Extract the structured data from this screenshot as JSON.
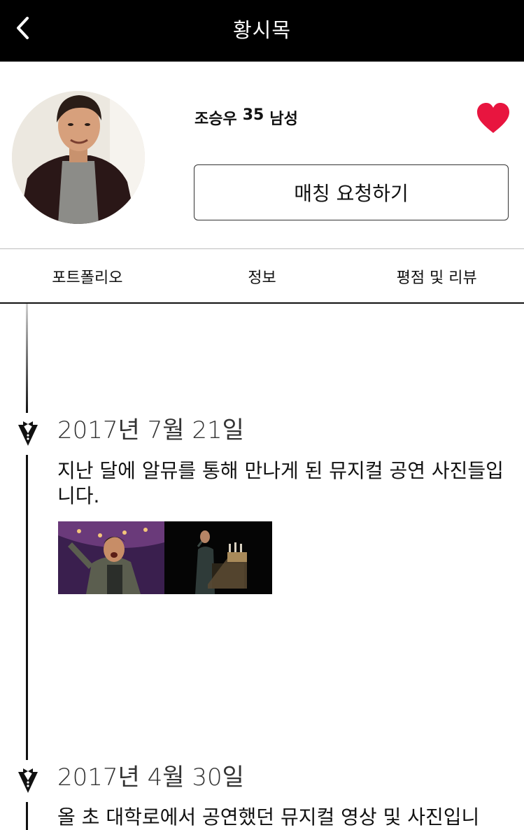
{
  "header": {
    "title": "황시목",
    "back_icon": "chevron-left-icon"
  },
  "profile": {
    "name": "조승우",
    "age": "35",
    "gender": "남성",
    "match_button": "매칭 요청하기",
    "favorite_icon": "heart-icon",
    "heart_color": "#e8153f"
  },
  "tabs": [
    {
      "label": "포트폴리오",
      "active": true
    },
    {
      "label": "정보",
      "active": false
    },
    {
      "label": "평점 및 리뷰",
      "active": false
    }
  ],
  "timeline": [
    {
      "date": "2017년 7월 21일",
      "text": "지난 달에 알뮤를 통해 만나게 된 뮤지컬 공연 사진들입니다.",
      "icon": "tuxedo-icon",
      "photos": [
        "performer-singing-photo",
        "performer-stage-photo"
      ]
    },
    {
      "date": "2017년 4월 30일",
      "text": "올 초 대학로에서 공연했던 뮤지컬 영상 및 사진입니",
      "icon": "tuxedo-icon"
    }
  ]
}
